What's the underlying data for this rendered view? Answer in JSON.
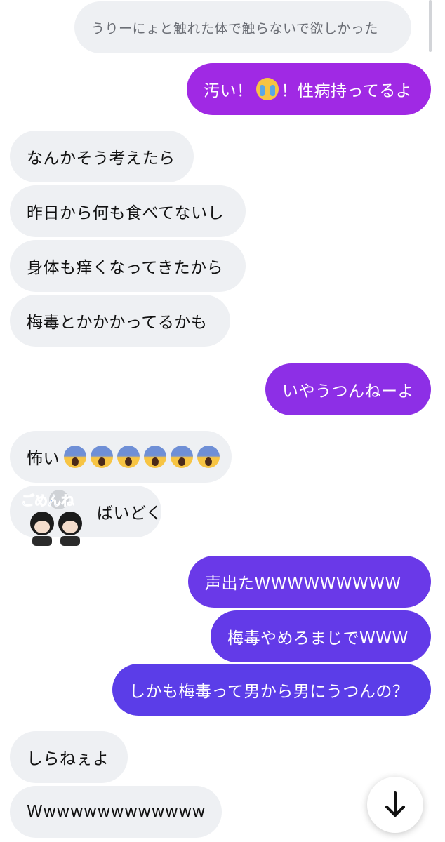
{
  "messages": {
    "m0": "うりーにょと触れた体で触らないで欲しかった",
    "m1_a": "汚い！",
    "m1_b": "！性病持ってるよ",
    "m2": "なんかそう考えたら",
    "m3": "昨日から何も食べてないし",
    "m4": "身体も痒くなってきたから",
    "m5": "梅毒とかかかってるかも",
    "m6": "いやうつんねーよ",
    "m7": "怖い",
    "m8": "ばいどく",
    "m9": "声出たWWWWWWWWW",
    "m10": "梅毒やめろまじでWWW",
    "m11": "しかも梅毒って男から男にうつんの？",
    "m12": "しらねぇよ",
    "m13": "Wwwwwwwwwwwww"
  },
  "sticker": {
    "text": "ごめんね"
  },
  "icons": {
    "m1_emoji": "loudly-crying-face",
    "m7_emoji": "face-screaming-in-fear",
    "scroll": "arrow-down-icon"
  },
  "colors": {
    "incoming_bubble": "#eef0f3",
    "outgoing_gradient_start": "#a029e4",
    "outgoing_gradient_end": "#5b3de8"
  }
}
